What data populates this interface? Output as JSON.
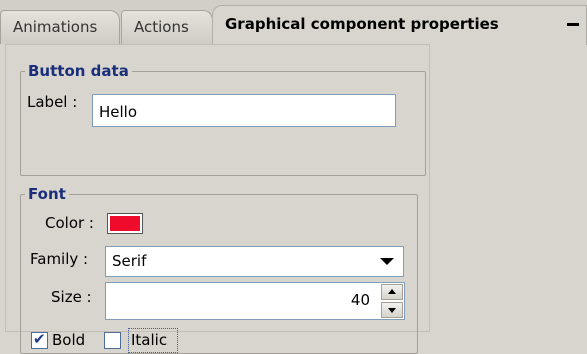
{
  "tabs": [
    {
      "label": "Animations",
      "active": false
    },
    {
      "label": "Actions",
      "active": false
    },
    {
      "label": "Graphical component properties",
      "active": true
    }
  ],
  "button_data": {
    "legend": "Button data",
    "label_caption": "Label :",
    "label_value": "Hello"
  },
  "font": {
    "legend": "Font",
    "color_caption": "Color :",
    "color_value": "#ee0c2a",
    "family_caption": "Family :",
    "family_value": "Serif",
    "size_caption": "Size :",
    "size_value": "40",
    "bold_label": "Bold",
    "bold_checked": true,
    "italic_label": "Italic",
    "italic_checked": false
  }
}
